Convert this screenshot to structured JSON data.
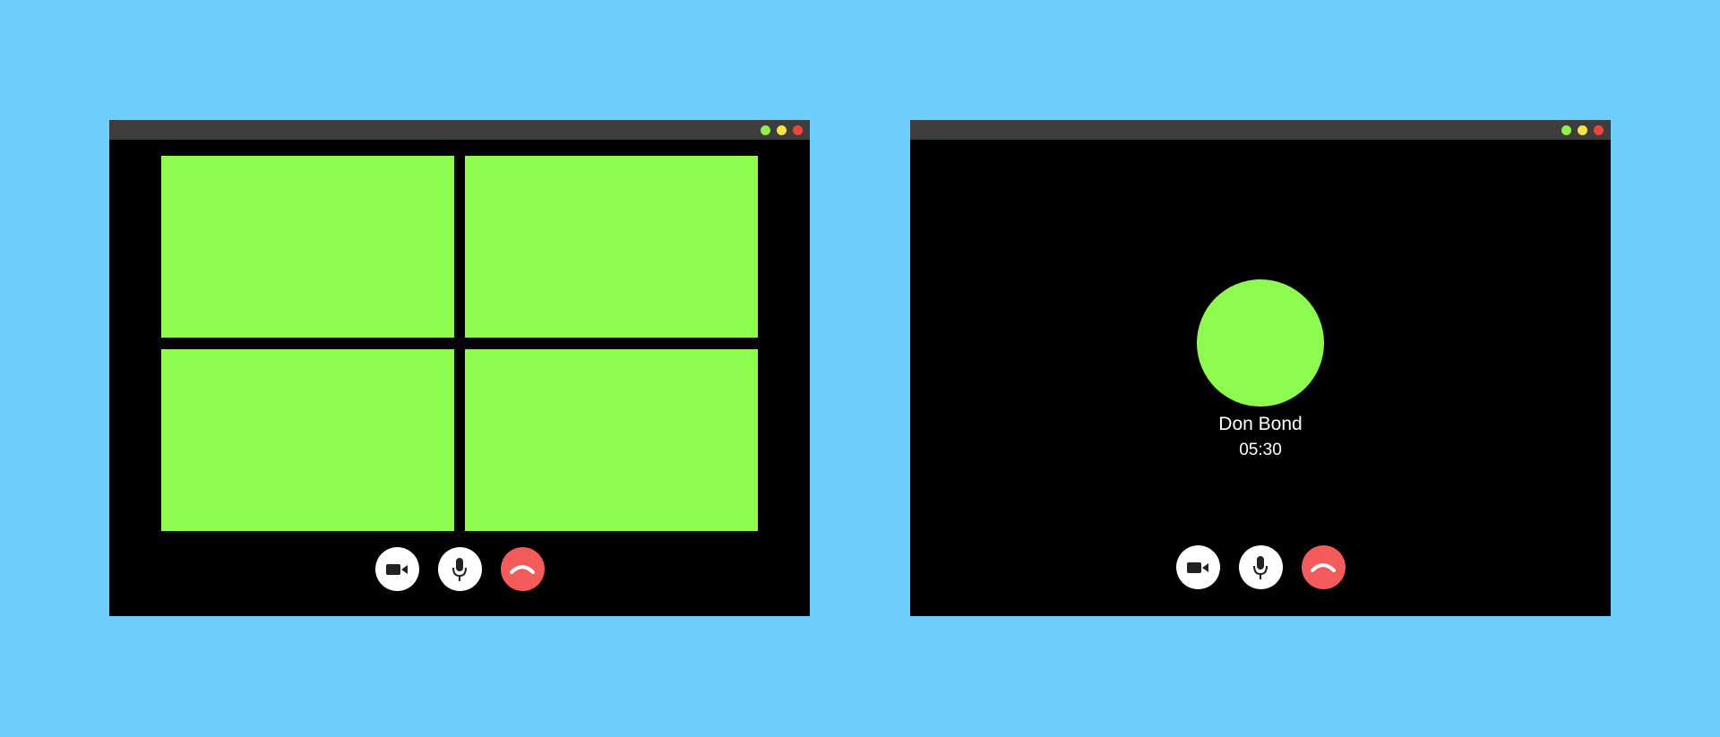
{
  "colors": {
    "background": "#6fcdfd",
    "window": "#000000",
    "titlebar": "#3d3d3d",
    "dot_green": "#8ef04f",
    "dot_yellow": "#f6e24a",
    "dot_red": "#f2443f",
    "video_tile": "#8efc4f",
    "control_button": "#ffffff",
    "end_call_button": "#f45c5c",
    "icon": "#222222"
  },
  "group_call": {
    "tiles": 4,
    "controls": [
      {
        "name": "camera-button",
        "icon": "video-camera-icon"
      },
      {
        "name": "microphone-button",
        "icon": "microphone-icon"
      },
      {
        "name": "end-call-button",
        "icon": "hang-up-phone-icon"
      }
    ]
  },
  "single_call": {
    "caller_name": "Don Bond",
    "call_duration": "05:30",
    "controls": [
      {
        "name": "camera-button",
        "icon": "video-camera-icon"
      },
      {
        "name": "microphone-button",
        "icon": "microphone-icon"
      },
      {
        "name": "end-call-button",
        "icon": "hang-up-phone-icon"
      }
    ]
  }
}
